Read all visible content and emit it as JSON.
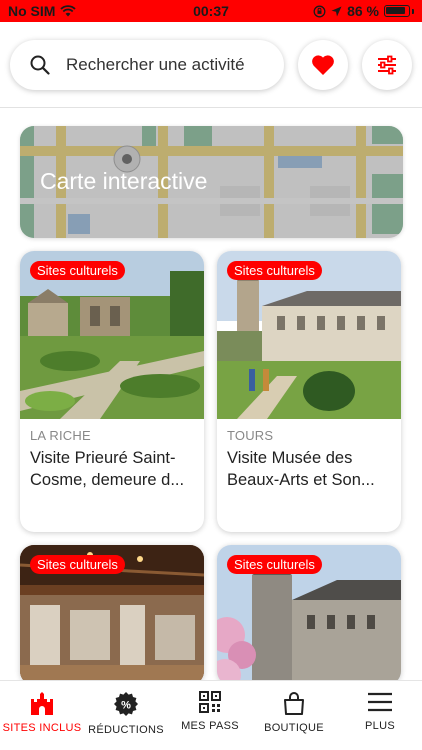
{
  "status_bar": {
    "carrier": "No SIM",
    "time": "00:37",
    "battery": "86 %"
  },
  "search": {
    "placeholder": "Rechercher une activité"
  },
  "map": {
    "label": "Carte interactive"
  },
  "cards": [
    {
      "badge": "Sites culturels",
      "location": "LA RICHE",
      "title": "Visite Prieuré Saint-Cosme, demeure d..."
    },
    {
      "badge": "Sites culturels",
      "location": "TOURS",
      "title": "Visite Musée des Beaux-Arts et Son..."
    },
    {
      "badge": "Sites culturels",
      "location": "",
      "title": ""
    },
    {
      "badge": "Sites culturels",
      "location": "",
      "title": ""
    }
  ],
  "tabs": [
    {
      "label": "SITES INCLUS",
      "icon": "castle-icon",
      "active": true
    },
    {
      "label": "RÉDUCTIONS",
      "icon": "discount-icon",
      "active": false
    },
    {
      "label": "MES PASS",
      "icon": "qr-code-icon",
      "active": false
    },
    {
      "label": "BOUTIQUE",
      "icon": "shopping-bag-icon",
      "active": false
    },
    {
      "label": "PLUS",
      "icon": "menu-icon",
      "active": false
    }
  ],
  "colors": {
    "accent": "#ff0000",
    "status_bar": "#ff0000"
  }
}
